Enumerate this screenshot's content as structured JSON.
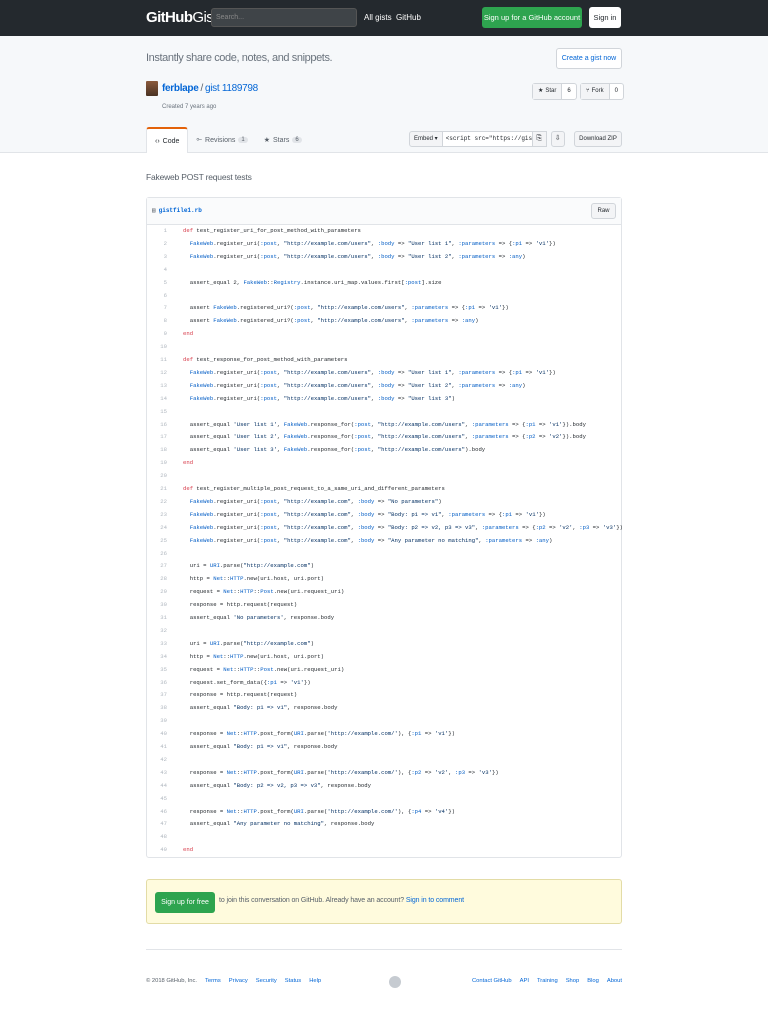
{
  "nav": {
    "logo_main": "GitHub",
    "logo_sub": "Gist",
    "search_placeholder": "Search...",
    "all_gists": "All gists",
    "github": "GitHub",
    "signup": "Sign up for a GitHub account",
    "signin": "Sign in"
  },
  "header": {
    "tagline": "Instantly share code, notes, and snippets.",
    "create_gist": "Create a gist now",
    "owner": "ferblape",
    "separator": "/",
    "gist_id": "gist 1189798",
    "created": "Created 7 years ago",
    "star_label": "Star",
    "star_count": "6",
    "fork_label": "Fork",
    "fork_count": "0"
  },
  "tabs": [
    {
      "label": "Code",
      "badge": ""
    },
    {
      "label": "Revisions",
      "badge": "1"
    },
    {
      "label": "Stars",
      "badge": "6"
    }
  ],
  "toolbar": {
    "embed_label": "Embed ▾",
    "embed_value": "<script src=\"https://gist.",
    "download_zip": "Download ZIP"
  },
  "description": "Fakeweb POST request tests",
  "file": {
    "name": "gistfile1.rb",
    "raw": "Raw"
  },
  "code_lines": [
    "def test_register_uri_for_post_method_with_parameters",
    "  FakeWeb.register_uri(:post, \"http://example.com/users\", :body => \"User list 1\", :parameters => {:p1 => 'v1'})",
    "  FakeWeb.register_uri(:post, \"http://example.com/users\", :body => \"User list 2\", :parameters => :any)",
    "",
    "  assert_equal 2, FakeWeb::Registry.instance.uri_map.values.first[:post].size",
    "",
    "  assert FakeWeb.registered_uri?(:post, \"http://example.com/users\", :parameters => {:p1 => 'v1'})",
    "  assert FakeWeb.registered_uri?(:post, \"http://example.com/users\", :parameters => :any)",
    "end",
    "",
    "def test_response_for_post_method_with_parameters",
    "  FakeWeb.register_uri(:post, \"http://example.com/users\", :body => \"User list 1\", :parameters => {:p1 => 'v1'})",
    "  FakeWeb.register_uri(:post, \"http://example.com/users\", :body => \"User list 2\", :parameters => :any)",
    "  FakeWeb.register_uri(:post, \"http://example.com/users\", :body => \"User list 3\")",
    "",
    "  assert_equal 'User list 1', FakeWeb.response_for(:post, \"http://example.com/users\", :parameters => {:p1 => 'v1'}).body",
    "  assert_equal 'User list 2', FakeWeb.response_for(:post, \"http://example.com/users\", :parameters => {:p2 => 'v2'}).body",
    "  assert_equal 'User list 3', FakeWeb.response_for(:post, \"http://example.com/users\").body",
    "end",
    "",
    "def test_register_multiple_post_request_to_a_same_uri_and_different_parameters",
    "  FakeWeb.register_uri(:post, \"http://example.com\", :body => \"No parameters\")",
    "  FakeWeb.register_uri(:post, \"http://example.com\", :body => \"Body: p1 => v1\", :parameters => {:p1 => 'v1'})",
    "  FakeWeb.register_uri(:post, \"http://example.com\", :body => \"Body: p2 => v2, p3 => v3\", :parameters => {:p2 => 'v2', :p3 => 'v3'})",
    "  FakeWeb.register_uri(:post, \"http://example.com\", :body => \"Any parameter no matching\", :parameters => :any)",
    "",
    "  uri = URI.parse(\"http://example.com\")",
    "  http = Net::HTTP.new(uri.host, uri.port)",
    "  request = Net::HTTP::Post.new(uri.request_uri)",
    "  response = http.request(request)",
    "  assert_equal 'No parameters', response.body",
    "",
    "  uri = URI.parse(\"http://example.com\")",
    "  http = Net::HTTP.new(uri.host, uri.port)",
    "  request = Net::HTTP::Post.new(uri.request_uri)",
    "  request.set_form_data({:p1 => 'v1'})",
    "  response = http.request(request)",
    "  assert_equal \"Body: p1 => v1\", response.body",
    "",
    "  response = Net::HTTP.post_form(URI.parse('http://example.com/'), {:p1 => 'v1'})",
    "  assert_equal \"Body: p1 => v1\", response.body",
    "",
    "  response = Net::HTTP.post_form(URI.parse('http://example.com/'), {:p2 => 'v2', :p3 => 'v3'})",
    "  assert_equal \"Body: p2 => v2, p3 => v3\", response.body",
    "",
    "  response = Net::HTTP.post_form(URI.parse('http://example.com/'), {:p4 => 'v4'})",
    "  assert_equal \"Any parameter no matching\", response.body",
    "",
    "end"
  ],
  "signup_banner": {
    "button": "Sign up for free",
    "text": "to join this conversation on GitHub.",
    "already": "Already have an account?",
    "signin_link": "Sign in to comment"
  },
  "footer": {
    "copyright": "© 2018 GitHub, Inc.",
    "left_links": [
      "Terms",
      "Privacy",
      "Security",
      "Status",
      "Help"
    ],
    "right_links": [
      "Contact GitHub",
      "API",
      "Training",
      "Shop",
      "Blog",
      "About"
    ]
  },
  "colors": {
    "nav_bg": "#24292e",
    "primary_green": "#2ea44f",
    "link_blue": "#0366d6",
    "tab_accent": "#e36209",
    "banner_bg": "#fffbdd"
  }
}
